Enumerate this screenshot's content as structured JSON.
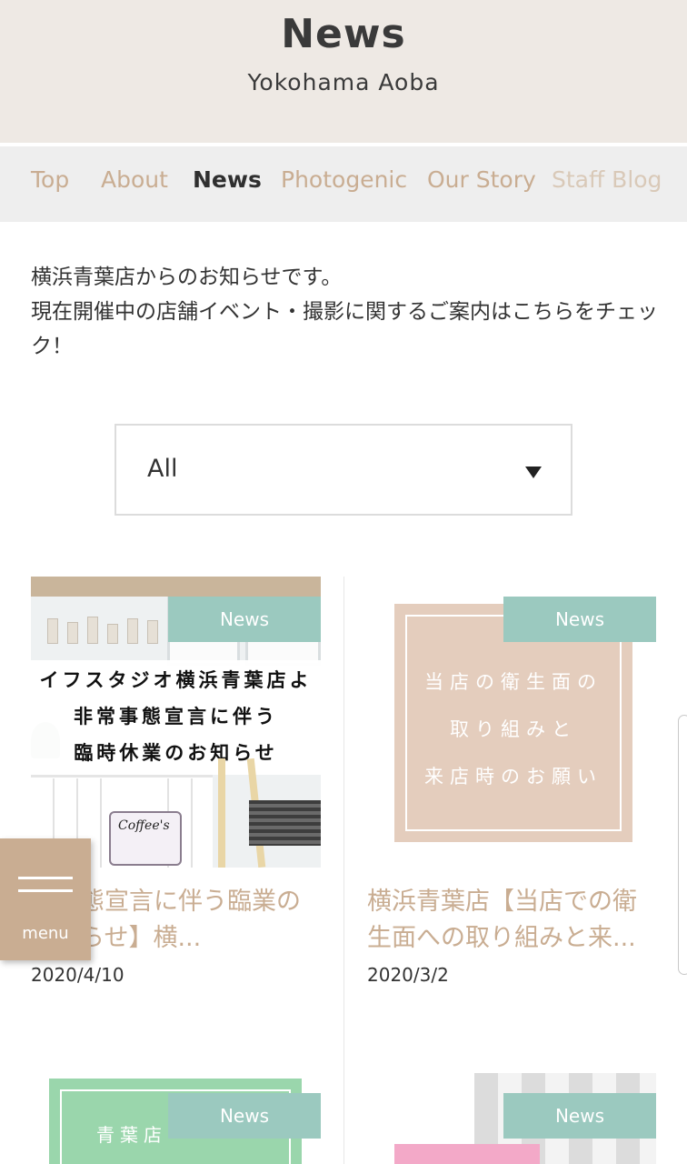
{
  "header": {
    "title": "News",
    "subtitle": "Yokohama Aoba"
  },
  "nav": {
    "items": [
      {
        "label": "Top"
      },
      {
        "label": "About"
      },
      {
        "label": "News"
      },
      {
        "label": "Photogenic"
      },
      {
        "label": "Our Story"
      },
      {
        "label": "Staff Blog"
      }
    ],
    "active": "News"
  },
  "intro": {
    "line1": "横浜青葉店からのお知らせです。",
    "line2": "現在開催中の店舗イベント・撮影に関するご案内はこちらをチェック！"
  },
  "filter": {
    "selected": "All"
  },
  "cards": [
    {
      "tag": "News",
      "image_text": [
        "イフスタジオ横浜青葉店よ",
        "非常事態宣言に伴う",
        "臨時休業のお知らせ"
      ],
      "image_sign": "Coffee's",
      "title": "急事態宣言に伴う臨業のお知らせ】横...",
      "date": "2020/4/10"
    },
    {
      "tag": "News",
      "image_text": [
        "当店の衛生面の",
        "取り組みと",
        "来店時のお願い"
      ],
      "title": "横浜青葉店【当店での衛生面への取り組みと来...",
      "date": "2020/3/2"
    },
    {
      "tag": "News",
      "image_text": [
        "青葉店"
      ]
    },
    {
      "tag": "News"
    }
  ],
  "menu": {
    "label": "menu"
  },
  "colors": {
    "accent": "#c9ad92",
    "tag_bg": "#9bc9bf",
    "header_bg": "#eee9e4",
    "nav_bg": "#eeeeee"
  }
}
